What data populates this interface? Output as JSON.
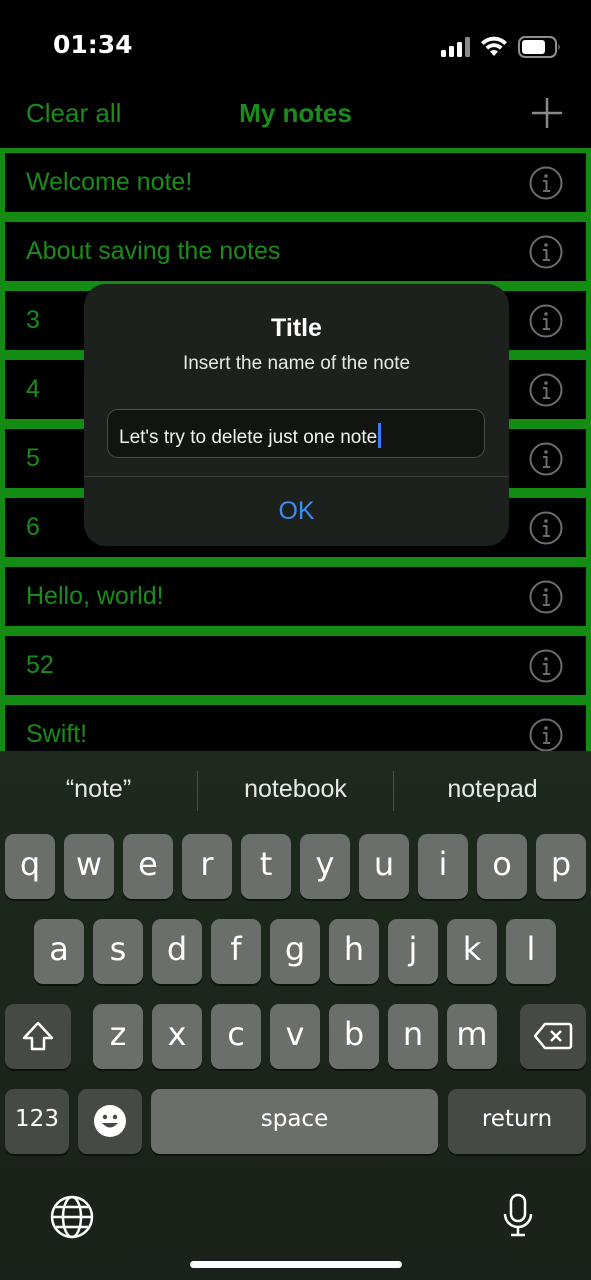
{
  "status_bar": {
    "time": "01:34"
  },
  "navbar": {
    "left_button": "Clear all",
    "title": "My notes",
    "add_icon": "plus-icon"
  },
  "notes": [
    {
      "title": "Welcome note!"
    },
    {
      "title": "About saving the notes"
    },
    {
      "title": "3"
    },
    {
      "title": "4"
    },
    {
      "title": "5"
    },
    {
      "title": "6"
    },
    {
      "title": "Hello, world!"
    },
    {
      "title": "52"
    },
    {
      "title": "Swift!"
    }
  ],
  "alert": {
    "title": "Title",
    "message": "Insert the name of the note",
    "input_value": "Let's try to delete just one note",
    "ok_label": "OK"
  },
  "keyboard": {
    "suggestions": [
      "“note”",
      "notebook",
      "notepad"
    ],
    "row1": [
      "q",
      "w",
      "e",
      "r",
      "t",
      "y",
      "u",
      "i",
      "o",
      "p"
    ],
    "row2": [
      "a",
      "s",
      "d",
      "f",
      "g",
      "h",
      "j",
      "k",
      "l"
    ],
    "row3": [
      "z",
      "x",
      "c",
      "v",
      "b",
      "n",
      "m"
    ],
    "numbers_label": "123",
    "space_label": "space",
    "return_label": "return"
  },
  "colors": {
    "accent_green": "#1a8c1a",
    "border_green": "#148c14",
    "alert_link_blue": "#3d8ef0"
  }
}
